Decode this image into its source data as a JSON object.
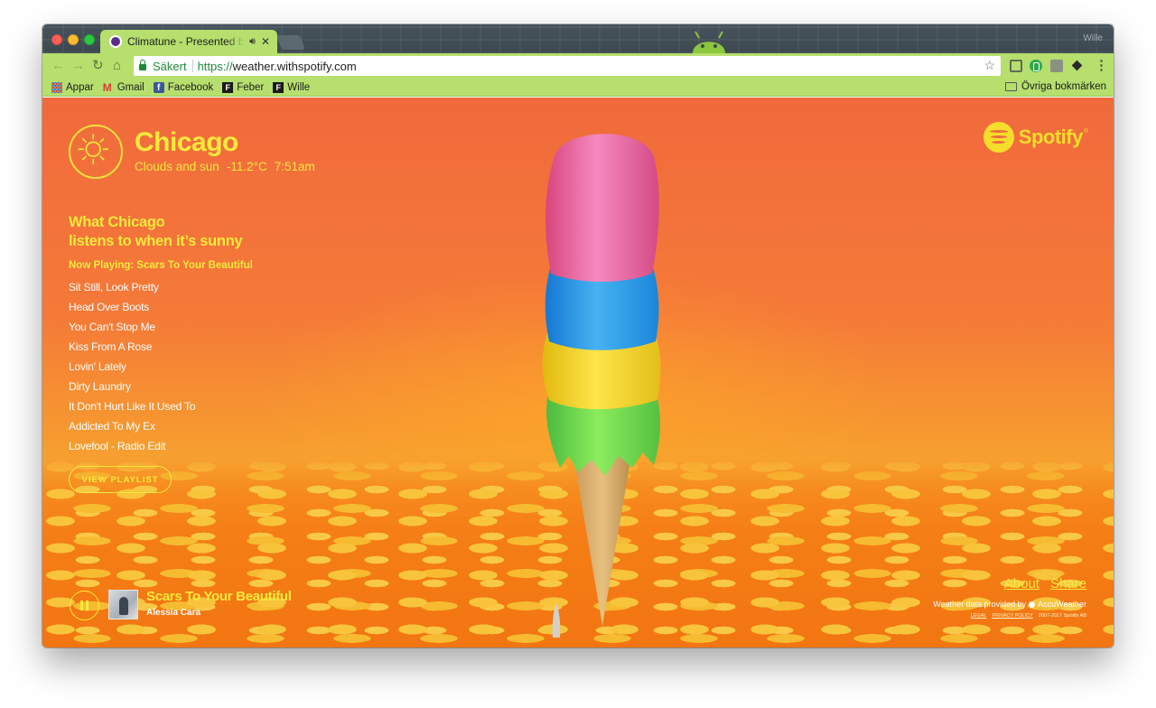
{
  "browser": {
    "tab": {
      "title": "Climatune - Presented by Spotify",
      "audio_icon": "speaker-icon",
      "close_icon": "close-icon"
    },
    "profile_name": "Wille",
    "address": {
      "secure_label": "Säkert",
      "url_scheme": "https://",
      "url_host": "weather.withspotify.com"
    },
    "bookmarks": [
      {
        "label": "Appar",
        "icon": "apps-icon"
      },
      {
        "label": "Gmail",
        "icon": "gmail-icon"
      },
      {
        "label": "Facebook",
        "icon": "facebook-icon"
      },
      {
        "label": "Feber",
        "icon": "feber-icon"
      },
      {
        "label": "Wille",
        "icon": "feber-icon"
      }
    ],
    "other_bookmarks": "Övriga bokmärken",
    "theme_color": "#b6df6e"
  },
  "weather": {
    "city": "Chicago",
    "condition": "Clouds and sun",
    "temperature": "-11.2°C",
    "time": "7:51am",
    "icon": "sun-icon"
  },
  "playlist": {
    "heading_line1": "What Chicago",
    "heading_line2": "listens to when it’s sunny",
    "now_playing": "Now Playing: Scars To Your Beautiful",
    "tracks": [
      "Sit Still, Look Pretty",
      "Head Over Boots",
      "You Can't Stop Me",
      "Kiss From A Rose",
      "Lovin' Lately",
      "Dirty Laundry",
      "It Don't Hurt Like It Used To",
      "Addicted To My Ex",
      "Lovefool - Radio Edit"
    ],
    "view_button": "VIEW PLAYLIST"
  },
  "brand": {
    "name": "Spotify",
    "accent": "#f8ea3c"
  },
  "player": {
    "title": "Scars To Your Beautiful",
    "artist": "Alessia Cara",
    "state_icon": "pause-icon"
  },
  "footer": {
    "about": "About",
    "share": "Share",
    "weather_credit": "Weather data provided by",
    "weather_provider": "AccuWeather",
    "legal": "LEGAL",
    "privacy": "PRIVACY POLICY",
    "copyright": "2007-2017 Spotify AB"
  }
}
